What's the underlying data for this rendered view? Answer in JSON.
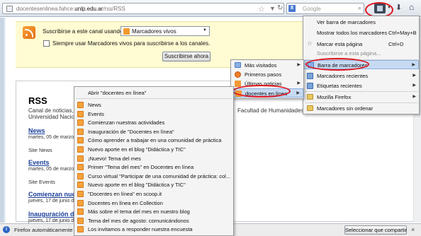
{
  "toolbar": {
    "url_prefix": "docentesenlinea.fahce.",
    "url_domain": "unlp.edu.ar",
    "url_path": "/rss/RSS",
    "search_engine_letter": "8",
    "search_placeholder": "Google"
  },
  "subscribe": {
    "label": "Suscribirse a este canal usando",
    "reader_selected": "Marcadores vivos",
    "always_use_label": "Siempre usar Marcadores vivos para suscribirse a los canales.",
    "button_label": "Suscribirse ahora"
  },
  "page": {
    "title": "RSS",
    "description_line1": "Canal de noticias, c",
    "description_line2": "Universidad Nacio",
    "description_tail": "Facultad de Humanidades y",
    "items": [
      {
        "title": "News",
        "date": "martes, 05 de marzo",
        "site": "Site News"
      },
      {
        "title": "Events",
        "date": "martes, 05 de marzo",
        "site": "Site Events"
      },
      {
        "title": "Comienzan nuest",
        "date": "jueves, 17 de junio de",
        "site": ""
      },
      {
        "title": "Inauguración de",
        "date": "jueves, 17 de junio de",
        "site": ""
      }
    ]
  },
  "statusbar": {
    "message": "Firefox automáticamente en",
    "share_button": "Seleccionar que compartir",
    "close": "×"
  },
  "bookmarks_menu": {
    "items": [
      {
        "label": "Ver barra de marcadores",
        "shortcut": "",
        "disabled": false
      },
      {
        "label": "Mostrar todos los marcadores",
        "shortcut": "Ctrl+May+B",
        "disabled": false
      },
      {
        "label": "Marcar esta página",
        "shortcut": "Ctrl+D",
        "disabled": false
      },
      {
        "label": "Suscribirse a esta página...",
        "shortcut": "",
        "disabled": true
      },
      {
        "label": "Barra de marcadores",
        "shortcut": "",
        "disabled": false
      },
      {
        "label": "Marcadores recientes",
        "shortcut": "",
        "disabled": false
      },
      {
        "label": "Etiquetas recientes",
        "shortcut": "",
        "disabled": false
      },
      {
        "label": "Mozilla Firefox",
        "shortcut": "",
        "disabled": false
      },
      {
        "label": "Marcadores sin ordenar",
        "shortcut": "",
        "disabled": false
      }
    ]
  },
  "toolbar_submenu": {
    "items": [
      "Más visitados",
      "Primeros pasos",
      "Últimas noticias",
      "docentes en línea"
    ]
  },
  "live_menu": {
    "open_all": "Abrir \"docentes en línea\"",
    "items": [
      "News",
      "Events",
      "Comienzan nuestras actividades",
      "Inauguración de \"Docentes en línea\"",
      "Cómo aprender a trabajar en una comunidad de práctica",
      "Nuevo aporte en el blog \"Didáctica y TIC\"",
      "¡Nuevo! Tema del mes",
      "Primer \"Tema del mes\" en Docentes en línea",
      "Curso virtual \"Participar de una comunidad de práctica: col...",
      "Nuevo aporte en el blog \"Didáctica y TIC\"",
      "\"Docentes en línea\" en scoop.it",
      "Docentes en línea en Collection",
      "Más sobre el tema del mes en nuestro blog",
      "Tema del mes de agosto: comunicándonos",
      "Los invitamos a responder nuestra encuesta"
    ]
  },
  "colors": {
    "highlight": "#c7daf2",
    "annotation_red": "#e0141e",
    "link_blue": "#1a3e9a",
    "subscribe_bg": "#fffbd2"
  }
}
